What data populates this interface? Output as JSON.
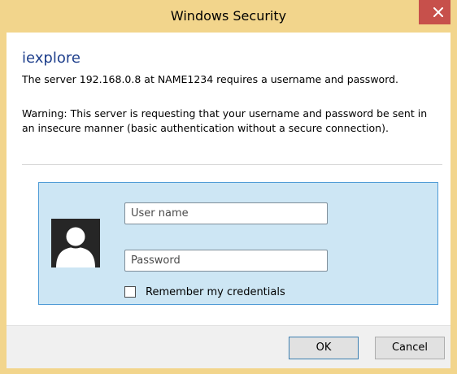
{
  "window": {
    "title": "Windows Security",
    "close_icon": "close-icon"
  },
  "dialog": {
    "app_name": "iexplore",
    "server_message": "The server 192.168.0.8 at NAME1234 requires a username and password.",
    "warning": "Warning: This server is requesting that your username and password be sent in an insecure manner (basic authentication without a secure connection)."
  },
  "credentials": {
    "avatar_icon": "user-avatar-icon",
    "username": {
      "placeholder": "User name",
      "value": ""
    },
    "password": {
      "placeholder": "Password",
      "value": ""
    },
    "remember_label": "Remember my credentials",
    "remember_checked": false
  },
  "buttons": {
    "ok_label": "OK",
    "cancel_label": "Cancel"
  },
  "colors": {
    "frame": "#f2d58c",
    "close_button": "#c7504b",
    "app_name": "#1e3f8c",
    "panel_background": "#cde6f4",
    "panel_border": "#4f9bd6",
    "footer": "#f0f0f0"
  }
}
